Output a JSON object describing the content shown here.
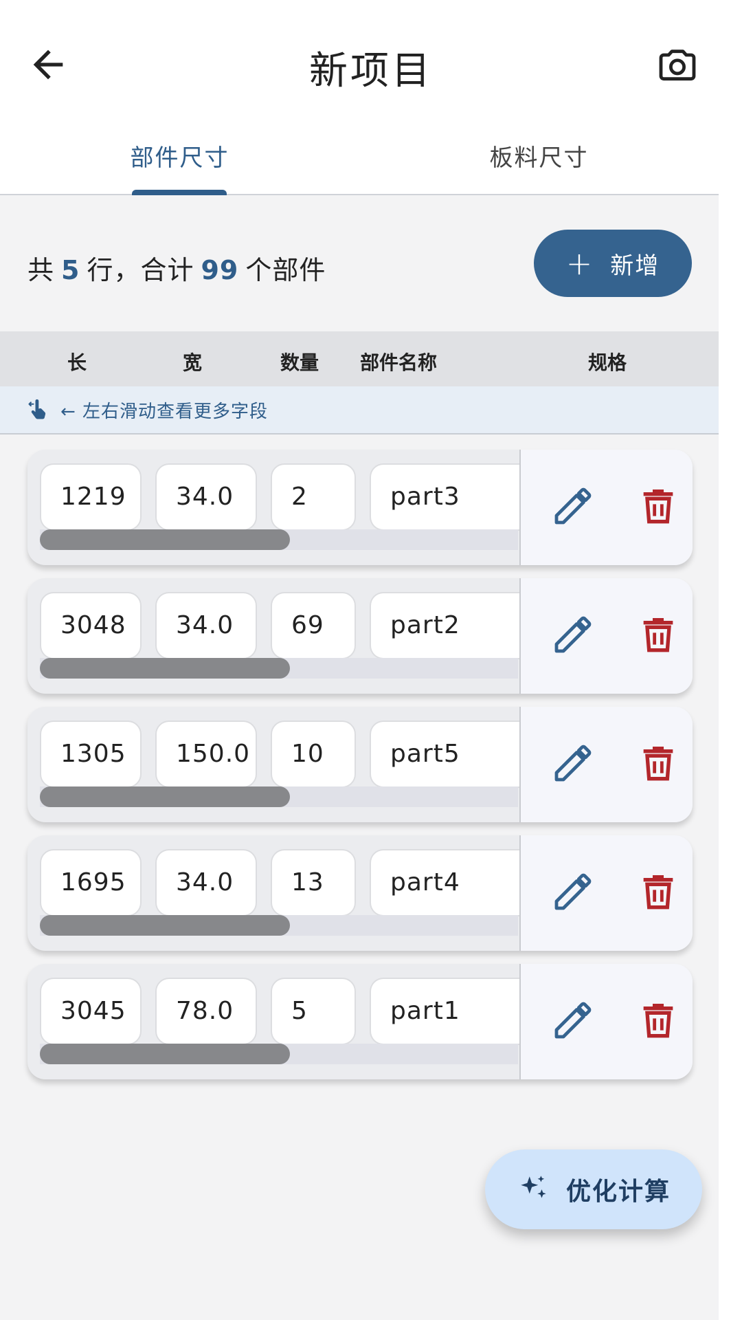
{
  "header": {
    "title": "新项目",
    "back_icon": "arrow-left-icon",
    "camera_icon": "camera-icon"
  },
  "tabs": [
    {
      "label": "部件尺寸",
      "active": true
    },
    {
      "label": "板料尺寸",
      "active": false
    }
  ],
  "summary": {
    "prefix": "共",
    "rows": "5",
    "middle": "行，合计",
    "parts": "99",
    "suffix": "个部件"
  },
  "add_button": {
    "label": "新增",
    "icon": "plus-icon"
  },
  "columns": [
    "长",
    "宽",
    "数量",
    "部件名称",
    "规格"
  ],
  "hint": {
    "icon": "swipe-hand-icon",
    "text": "← 左右滑动查看更多字段"
  },
  "rows": [
    {
      "length": "1219",
      "width": "34.0",
      "qty": "2",
      "name": "part3"
    },
    {
      "length": "3048",
      "width": "34.0",
      "qty": "69",
      "name": "part2"
    },
    {
      "length": "1305",
      "width": "150.0",
      "qty": "10",
      "name": "part5"
    },
    {
      "length": "1695",
      "width": "34.0",
      "qty": "13",
      "name": "part4"
    },
    {
      "length": "3045",
      "width": "78.0",
      "qty": "5",
      "name": "part1"
    }
  ],
  "row_scroll_position": 0.4,
  "fab": {
    "label": "优化计算",
    "icon": "sparkle-icon"
  },
  "colors": {
    "accent": "#35638f",
    "delete": "#b3262b",
    "fab_bg": "#d0e4fb"
  }
}
